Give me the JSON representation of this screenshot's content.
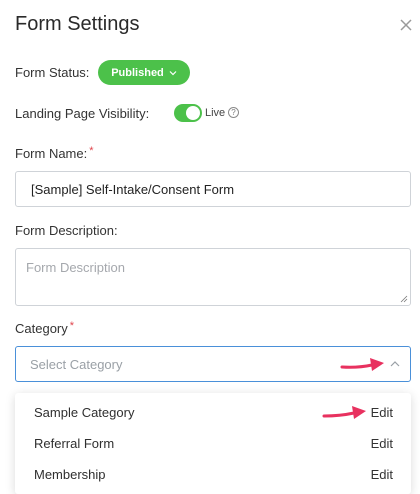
{
  "dialog": {
    "title": "Form Settings",
    "close_icon": "close-icon"
  },
  "form_status": {
    "label": "Form Status:",
    "value": "Published",
    "color": "#4cc14a"
  },
  "landing_page": {
    "label": "Landing Page Visibility:",
    "toggle_state": "on",
    "toggle_label": "Live",
    "help_icon": "?"
  },
  "form_name": {
    "label": "Form Name:",
    "required_mark": "*",
    "value": "[Sample] Self-Intake/Consent Form"
  },
  "form_description": {
    "label": "Form Description:",
    "placeholder": "Form Description"
  },
  "category": {
    "label": "Category",
    "required_mark": "*",
    "placeholder": "Select Category",
    "options": [
      {
        "name": "Sample Category",
        "action": "Edit"
      },
      {
        "name": "Referral Form",
        "action": "Edit"
      },
      {
        "name": "Membership",
        "action": "Edit"
      }
    ]
  },
  "annotation_color": "#e8315f"
}
